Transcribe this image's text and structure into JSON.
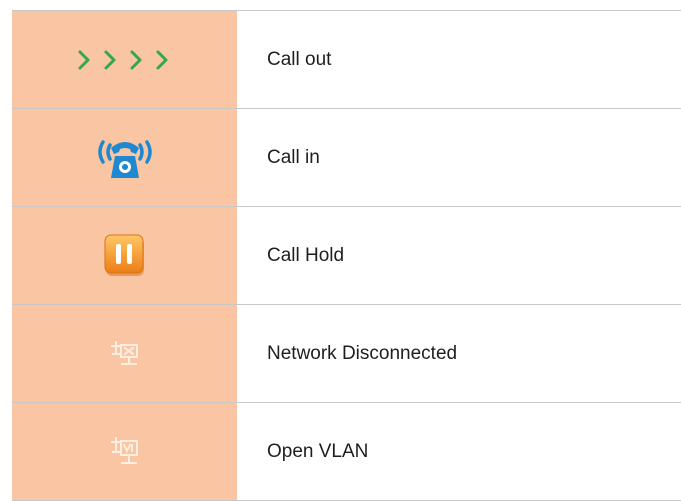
{
  "rows": [
    {
      "icon": "call-out-chevrons-icon",
      "label": "Call out"
    },
    {
      "icon": "ringing-phone-icon",
      "label": "Call in"
    },
    {
      "icon": "pause-icon",
      "label": "Call Hold"
    },
    {
      "icon": "network-disconnected-icon",
      "label": "Network Disconnected"
    },
    {
      "icon": "open-vlan-icon",
      "label": "Open VLAN"
    }
  ],
  "colors": {
    "icon_cell_bg": "#f9c5a3",
    "call_out_green": "#33a84a",
    "call_in_blue": "#1e88d0",
    "hold_orange": "#f08a1e",
    "network_icon_light": "#fdeee2"
  }
}
